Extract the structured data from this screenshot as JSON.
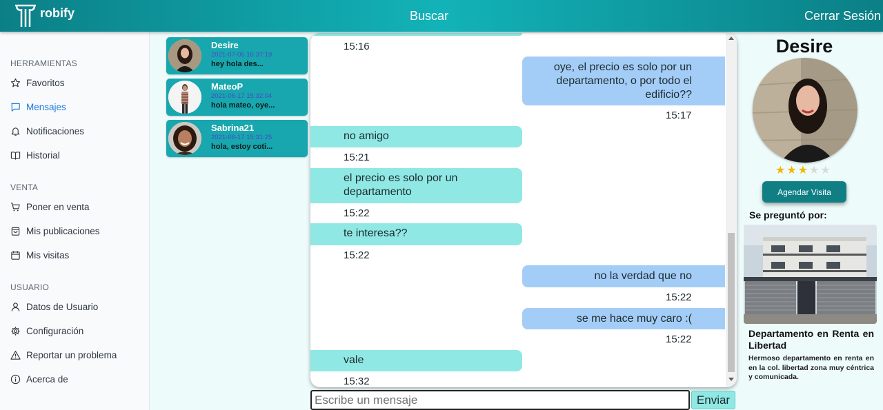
{
  "header": {
    "logo_text": "robify",
    "search_label": "Buscar",
    "logout_label": "Cerrar Sesión"
  },
  "sidebar": {
    "sections": [
      {
        "title": "HERRAMIENTAS",
        "items": [
          {
            "label": "Favoritos",
            "icon": "star-icon"
          },
          {
            "label": "Mensajes",
            "icon": "message-icon",
            "active": true
          },
          {
            "label": "Notificaciones",
            "icon": "bell-icon"
          },
          {
            "label": "Historial",
            "icon": "book-icon"
          }
        ]
      },
      {
        "title": "VENTA",
        "items": [
          {
            "label": "Poner en venta",
            "icon": "cart-icon"
          },
          {
            "label": "Mis publicaciones",
            "icon": "bag-icon"
          },
          {
            "label": "Mis visitas",
            "icon": "calendar-icon"
          }
        ]
      },
      {
        "title": "USUARIO",
        "items": [
          {
            "label": "Datos de Usuario",
            "icon": "user-icon"
          },
          {
            "label": "Configuración",
            "icon": "gear-icon"
          },
          {
            "label": "Reportar un problema",
            "icon": "warning-icon"
          },
          {
            "label": "Acerca de",
            "icon": "info-icon"
          }
        ]
      }
    ]
  },
  "conversations": [
    {
      "name": "Desire",
      "date": "2021-07-05 16:37:19",
      "preview": "hey hola des..."
    },
    {
      "name": "MateoP",
      "date": "2021-06-17 15:32:04",
      "preview": "hola mateo, oye..."
    },
    {
      "name": "Sabrina21",
      "date": "2021-06-17 15:31:25",
      "preview": "hola, estoy coti..."
    }
  ],
  "chat": {
    "messages": [
      {
        "side": "in",
        "text": "",
        "time": "15:16"
      },
      {
        "side": "out",
        "text": "oye, el precio es solo por un departamento, o por todo el edificio??",
        "time": "15:17"
      },
      {
        "side": "in",
        "text": "no amigo",
        "time": "15:21"
      },
      {
        "side": "in",
        "text": "el precio es solo por un departamento",
        "time": "15:22"
      },
      {
        "side": "in",
        "text": "te interesa??",
        "time": "15:22"
      },
      {
        "side": "out",
        "text": "no la verdad que no",
        "time": "15:22"
      },
      {
        "side": "out",
        "text": "se me hace muy caro :(",
        "time": "15:22"
      },
      {
        "side": "in",
        "text": "vale",
        "time": "15:32"
      }
    ],
    "input_placeholder": "Escribe un mensaje",
    "send_label": "Enviar"
  },
  "profile": {
    "name": "Desire",
    "rating": 3,
    "rating_max": 5,
    "schedule_label": "Agendar Visita",
    "asked_label": "Se preguntó por:",
    "property_title": "Departamento en Renta en Libertad",
    "property_description": "Hermoso departamento en renta en en la col. libertad zona muy céntrica y comunicada."
  },
  "colors": {
    "header": "#12b3b8",
    "incoming_bubble": "#8fe8e3",
    "outgoing_bubble": "#a3cdf7",
    "conversation_card": "#18a7ae",
    "active_nav": "#1f7ae0",
    "star": "#f5b400"
  }
}
